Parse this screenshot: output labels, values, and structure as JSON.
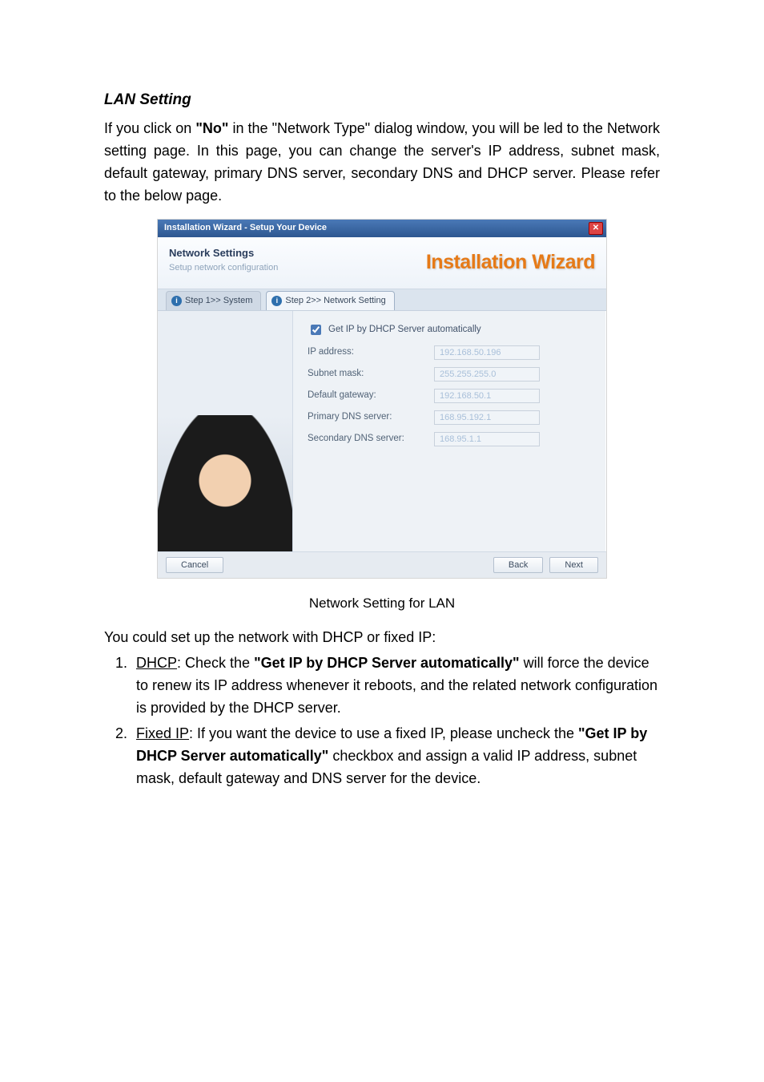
{
  "heading": "LAN Setting",
  "intro": {
    "pre_no": "If you click on ",
    "no_quoted": "\"No\"",
    "post_no": " in the \"Network Type\" dialog window, you will be led to the Network setting page. In this page, you can change the server's IP address, subnet mask, default gateway, primary DNS server, secondary DNS and DHCP server. Please refer to the below page."
  },
  "screenshot": {
    "titlebar": "Installation Wizard - Setup Your Device",
    "close_label": "✕",
    "header_title": "Network Settings",
    "header_sub": "Setup network configuration",
    "brand": "Installation Wizard",
    "tab1": "Step 1>> System",
    "tab2": "Step 2>> Network Setting",
    "checkbox_label": "Get IP by DHCP Server automatically",
    "fields": {
      "ip_label": "IP address:",
      "ip_value": "192.168.50.196",
      "mask_label": "Subnet mask:",
      "mask_value": "255.255.255.0",
      "gw_label": "Default gateway:",
      "gw_value": "192.168.50.1",
      "dns1_label": "Primary DNS server:",
      "dns1_value": "168.95.192.1",
      "dns2_label": "Secondary DNS server:",
      "dns2_value": "168.95.1.1"
    },
    "btn_cancel": "Cancel",
    "btn_back": "Back",
    "btn_next": "Next"
  },
  "caption": "Network Setting for LAN",
  "after_lead": "You could set up the network with DHCP or fixed IP:",
  "list": {
    "item1": {
      "term": "DHCP",
      "colon": ": Check the ",
      "bold": "\"Get IP by DHCP Server automatically\"",
      "rest": " will force the device to renew its IP address whenever it reboots, and the related network configuration is provided by the DHCP server."
    },
    "item2": {
      "term": "Fixed IP",
      "colon": ": If you want the device to use a fixed IP, please uncheck the ",
      "bold": "\"Get IP by DHCP Server automatically\"",
      "rest": " checkbox and assign a valid IP address, subnet mask, default gateway and DNS server for the device."
    }
  }
}
